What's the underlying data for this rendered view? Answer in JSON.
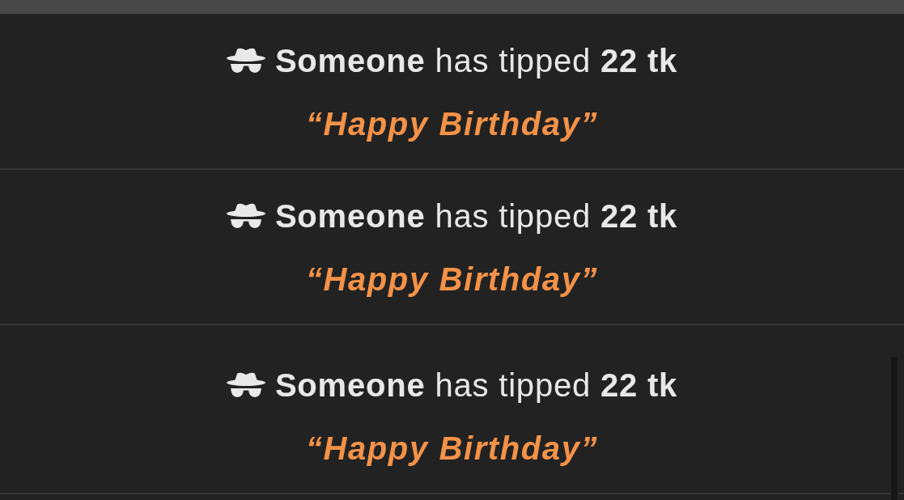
{
  "tips": [
    {
      "headline": "**Someone** has tipped **22 tk**",
      "message": "“Happy Birthday”"
    },
    {
      "headline": "**Someone** has tipped **22 tk**",
      "message": "“Happy Birthday”"
    },
    {
      "headline": "**Someone** has tipped **22 tk**",
      "message": "“Happy Birthday”"
    }
  ]
}
